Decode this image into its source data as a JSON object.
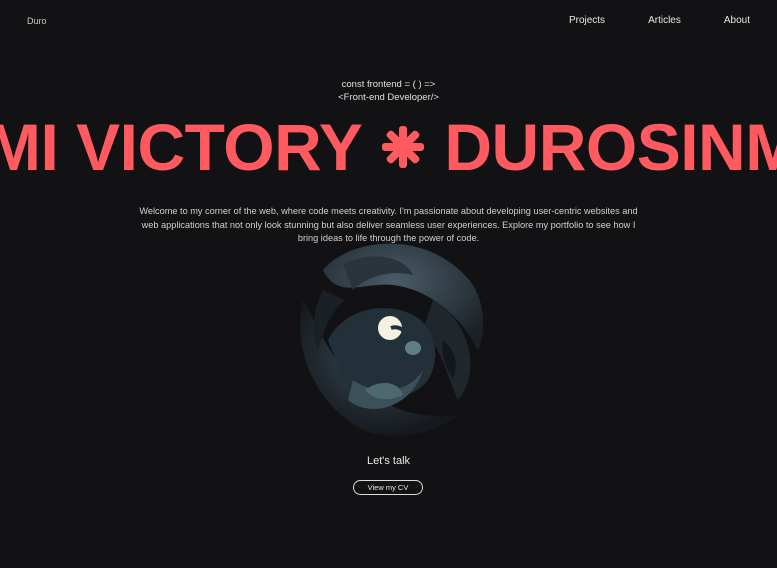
{
  "brand": {
    "logo_text": "Duro"
  },
  "nav": {
    "items": [
      "Projects",
      "Articles",
      "About"
    ]
  },
  "hero": {
    "code_line_1": "const frontend = ( ) =>",
    "code_line_2": "<Front-end Developer/>",
    "marquee_part_1": "MI VICTORY",
    "marquee_part_2": "DUROSINM",
    "marquee_separator_icon": "asterisk-icon",
    "intro": "Welcome to my corner of the web, where code meets creativity. I'm passionate about developing user-centric websites and web applications that not only look stunning but also deliver seamless user experiences. Explore my portfolio to see how I bring ideas to life through the power of code."
  },
  "cta": {
    "talk_label": "Let's talk",
    "cv_button": "View my CV"
  },
  "colors": {
    "background": "#121214",
    "accent": "#ff5a5f"
  }
}
